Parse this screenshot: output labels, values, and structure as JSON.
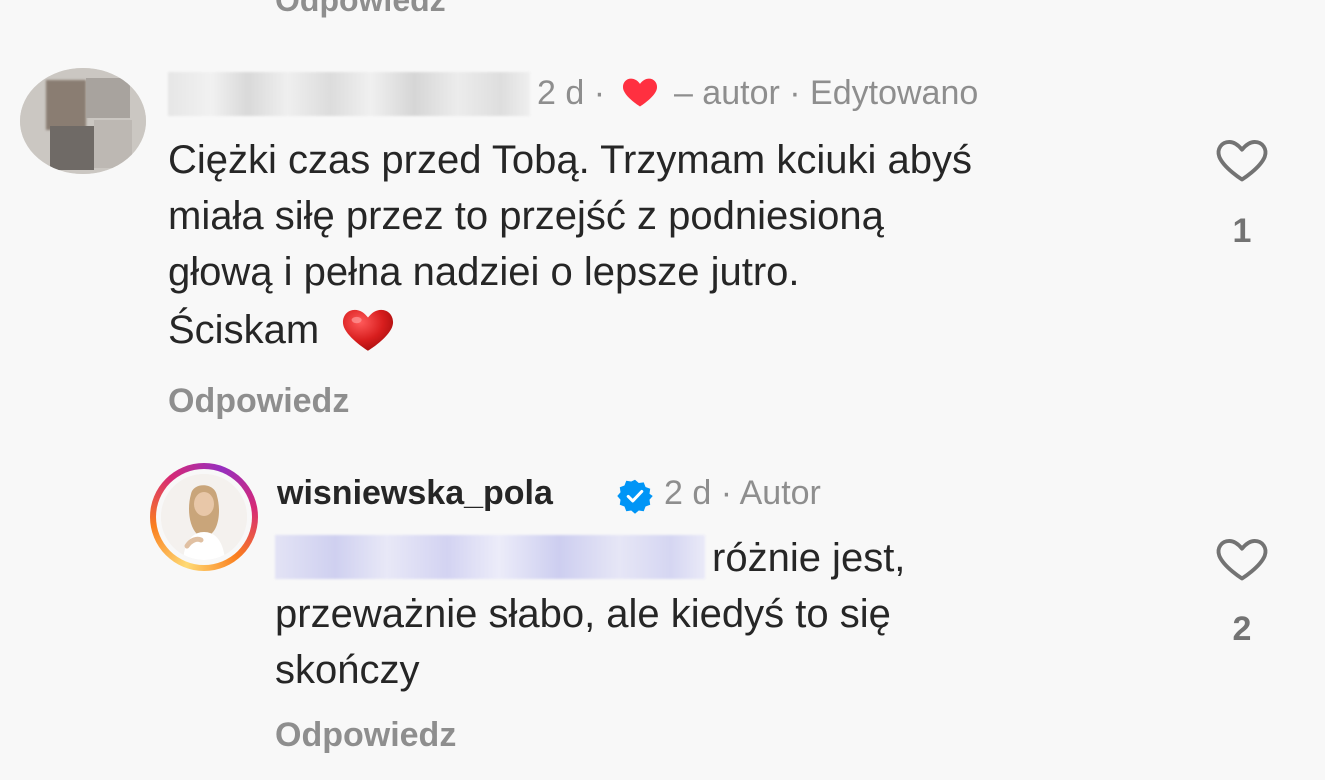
{
  "top_partial": {
    "reply_label": "Odpowiedz"
  },
  "comment1": {
    "time": "2 d",
    "separator": "·",
    "liked_by": "– autor",
    "edited": "· Edytowano",
    "text_lines": [
      "Ciężki czas przed Tobą. Trzymam kciuki abyś",
      "miała siłę przez to przejść z podniesioną",
      "głową i pełna nadziei o lepsze jutro."
    ],
    "sign_off": "Ściskam",
    "reply_label": "Odpowiedz",
    "like_count": "1"
  },
  "comment2": {
    "username": "wisniewska_pola",
    "time": "2 d",
    "role": "· Autor",
    "text_first": "różnie jest,",
    "text_lines": [
      "przeważnie słabo, ale kiedyś to się",
      "skończy"
    ],
    "reply_label": "Odpowiedz",
    "like_count": "2"
  },
  "colors": {
    "heart_red": "#ff3040",
    "verified_blue": "#0095f6",
    "muted_text": "#8e8e8e"
  },
  "icons": {
    "like": "heart-outline-icon",
    "author_liked": "heart-filled-icon",
    "verified": "verified-badge-icon",
    "emoji": "red-heart-emoji"
  }
}
